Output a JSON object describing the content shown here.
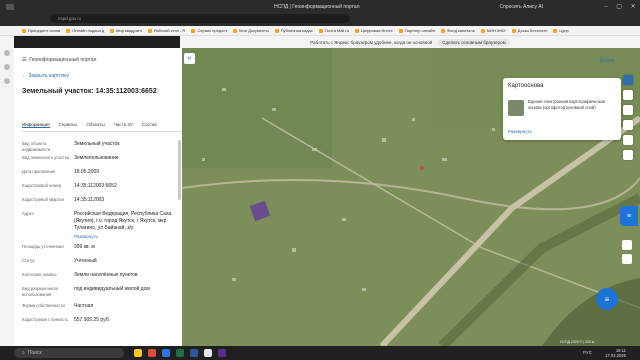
{
  "browser": {
    "tab_title": "НСПД | Геоинформационный портал",
    "address": "nspd.gov.ru",
    "user": "Спросить Алису AI",
    "bookmarks": [
      "Прецедент основ",
      "Онлайн подача д",
      "Мир квадратн",
      "Рабочий стол - R",
      "Сервис предост",
      "Мои Документы",
      "Публичная кадас",
      "Почта Mail.ru",
      "Цифровая Ипоте",
      "Партнер онлайн",
      "Фонд капиталь",
      "МИН ЖКХ",
      "Доска Бесплатн",
      "Цупр"
    ],
    "yandex_bar_text": "Работать с Яндекс браузером удобнее, когда он основной",
    "yandex_bar_button": "Сделать основным браузером"
  },
  "panel": {
    "portal_title": "Геоинформационный портал",
    "back_label": "Закрыть карточку",
    "heading": "Земельный участок: 14:35:112003:6652",
    "tabs": [
      "Информация",
      "Сервисы",
      "Объекты",
      "Части ЗУ",
      "Состав"
    ],
    "rows": [
      {
        "k": "Вид объекта недвижимости",
        "v": "Земельный участок"
      },
      {
        "k": "Вид земельного участка",
        "v": "Землепользование"
      },
      {
        "k": "Дата присвоения",
        "v": "18.05.2009"
      },
      {
        "k": "Кадастровый номер",
        "v": "14:35:112003:6652"
      },
      {
        "k": "Кадастровый квартал",
        "v": "14:35:112003"
      },
      {
        "k": "Адрес",
        "v": "Российская Федерация, Республика Саха (Якутия), г.о. город Якутск, г Якутск, мкр. Тулагино, ул Байанай, з/у"
      },
      {
        "k": "Площадь уточненная",
        "v": "999 кв. м"
      },
      {
        "k": "Статус",
        "v": "Учтенный"
      },
      {
        "k": "Категория земель",
        "v": "Земли населённых пунктов"
      },
      {
        "k": "Вид разрешенного использования",
        "v": "под индивидуальный жилой дом"
      },
      {
        "k": "Форма собственности",
        "v": "Частная"
      },
      {
        "k": "Кадастровая стоимость",
        "v": "557 905,25 руб."
      }
    ],
    "expand_label": "Развернуть"
  },
  "map": {
    "login": "Войти",
    "card_title": "Картооснова",
    "card_desc": "Единая электронная картографическая основа (ортофото)(основной слой)",
    "card_link": "Развернуть",
    "copyright": "НСПД 2025 © | 200 м"
  },
  "taskbar": {
    "search": "Поиск",
    "time": "16:11",
    "date": "17.03.2025",
    "lang": "РУС"
  }
}
